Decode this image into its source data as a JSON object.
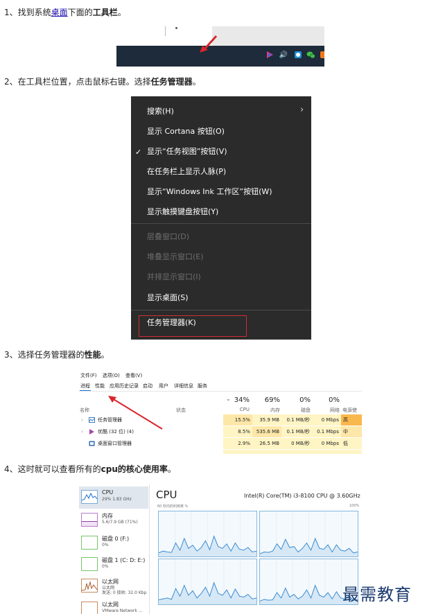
{
  "steps": {
    "s1": {
      "num": "1、",
      "pre": "找到系统",
      "link": "桌面",
      "mid": "下面的",
      "bold": "工具栏",
      "end": "。"
    },
    "s2": {
      "num": "2、",
      "pre": "在工具栏位置，点击鼠标右键。选择",
      "bold": "任务管理器",
      "end": "。"
    },
    "s3": {
      "num": "3、",
      "pre": "选择任务管理器的",
      "bold": "性能",
      "end": "。"
    },
    "s4": {
      "num": "4、",
      "pre": "这时就可以查看所有的",
      "bold": "cpu的核心使用率",
      "end": "。"
    }
  },
  "taskbar": {
    "colors": {
      "bar": "#1d2b3a",
      "arrow": "#d9262c"
    },
    "tray_icons": [
      "app-icon",
      "volume-icon",
      "app-icon-2",
      "wechat-icon",
      "orange-app-icon"
    ],
    "volume_glyph": "🔊"
  },
  "context_menu": {
    "items": [
      {
        "label": "搜索(H)",
        "disabled": false
      },
      {
        "label": "显示 Cortana 按钮(O)",
        "disabled": false
      },
      {
        "label": "显示“任务视图”按钮(V)",
        "disabled": false
      },
      {
        "label": "在任务栏上显示人脉(P)",
        "disabled": false
      },
      {
        "label": "显示“Windows Ink 工作区”按钮(W)",
        "disabled": false
      },
      {
        "label": "显示触摸键盘按钮(Y)",
        "disabled": false
      },
      {
        "label": "层叠窗口(D)",
        "disabled": true
      },
      {
        "label": "堆叠显示窗口(E)",
        "disabled": true
      },
      {
        "label": "并排显示窗口(I)",
        "disabled": true
      },
      {
        "label": "显示桌面(S)",
        "disabled": false
      },
      {
        "label": "任务管理器(K)",
        "disabled": false
      }
    ],
    "check_glyph": "✓",
    "chevron_glyph": "›"
  },
  "task_manager": {
    "menu": [
      "文件(F)",
      "选项(O)",
      "查看(V)"
    ],
    "tabs": [
      "进程",
      "性能",
      "应用历史记录",
      "启动",
      "用户",
      "详细信息",
      "服务"
    ],
    "headers": {
      "name": "名称",
      "status": "状态",
      "cpu_pct": "34%",
      "cpu": "CPU",
      "mem_pct": "69%",
      "mem": "内存",
      "disk_pct": "0%",
      "disk": "磁盘",
      "net_pct": "0%",
      "net": "网络",
      "power": "电源使"
    },
    "sort_glyph": "⌄",
    "rows": [
      {
        "expand": "›",
        "name": "任务管理器",
        "cpu": "15.5%",
        "mem": "35.9 MB",
        "disk": "0.1 MB/秒",
        "net": "0 Mbps",
        "power": "高"
      },
      {
        "expand": "›",
        "name": "优酷 (32 位) (4)",
        "cpu": "8.5%",
        "mem": "535.6 MB",
        "disk": "0.1 MB/秒",
        "net": "0.1 Mbps",
        "power": "中"
      },
      {
        "expand": "",
        "name": "桌面窗口管理器",
        "cpu": "2.9%",
        "mem": "26.5 MB",
        "disk": "0 MB/秒",
        "net": "0 Mbps",
        "power": "低"
      }
    ]
  },
  "performance": {
    "title": "CPU",
    "model": "Intel(R) Core(TM) i3-8100 CPU @ 3.60GHz",
    "util_label": "60 秒内的利用率 %",
    "max_label": "100%",
    "sidebar": [
      {
        "name": "CPU",
        "sub": "29% 1.83 GHz",
        "color": "#1a6fd0",
        "selected": true
      },
      {
        "name": "内存",
        "sub": "5.6/7.9 GB (71%)",
        "color": "#8b3fa8",
        "selected": false
      },
      {
        "name": "磁盘 0 (F:)",
        "sub": "0%",
        "color": "#4aa33a",
        "selected": false
      },
      {
        "name": "磁盘 1 (C: D: E:)",
        "sub": "0%",
        "color": "#4aa33a",
        "selected": false
      },
      {
        "name": "以太网",
        "sub": "以太网\n发送: 0 接收: 32.0 Kbp",
        "color": "#a8582a",
        "selected": false
      },
      {
        "name": "以太网",
        "sub": "VMware Network ...",
        "color": "#a8582a",
        "selected": false
      }
    ],
    "core_series": [
      [
        8,
        12,
        10,
        9,
        30,
        14,
        40,
        18,
        25,
        12,
        20,
        35,
        15,
        45,
        22,
        18,
        28,
        12,
        30,
        16,
        14,
        20,
        10,
        12
      ],
      [
        6,
        10,
        9,
        12,
        28,
        16,
        38,
        20,
        22,
        10,
        18,
        30,
        14,
        40,
        18,
        16,
        26,
        10,
        26,
        14,
        12,
        18,
        8,
        10
      ],
      [
        10,
        12,
        14,
        11,
        35,
        18,
        42,
        20,
        30,
        14,
        24,
        38,
        18,
        48,
        24,
        20,
        32,
        14,
        34,
        18,
        16,
        22,
        12,
        14
      ],
      [
        7,
        11,
        9,
        10,
        26,
        14,
        36,
        16,
        22,
        12,
        18,
        32,
        14,
        42,
        20,
        16,
        26,
        12,
        28,
        14,
        12,
        18,
        9,
        11
      ]
    ]
  },
  "watermark": "最需教育"
}
